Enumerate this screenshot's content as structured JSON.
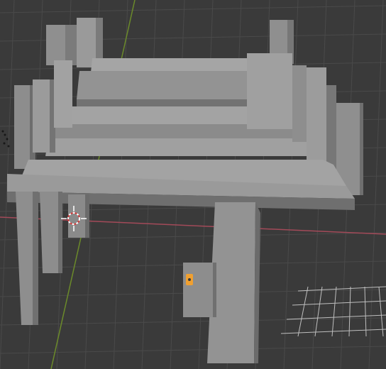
{
  "viewport": {
    "background_color": "#3a3a3a",
    "grid_line_color": "#4a4a4a",
    "grid_highlight_color": "#dcdcdc",
    "x_axis_color": "#a34a59",
    "y_axis_color": "#6b8a2a"
  },
  "scene": {
    "object_color": "#8f8f8f",
    "object_shadow_color": "#6f6f6f",
    "object_highlight_color": "#a5a5a5",
    "selected_object_color": "#f0a030",
    "cursor_color": "#ffffff",
    "cursor_accent_color": "#d33b3b"
  },
  "icons": {
    "3d_cursor": "3d-cursor-icon",
    "light": "light-object-icon",
    "camera": "camera-object-icon"
  }
}
